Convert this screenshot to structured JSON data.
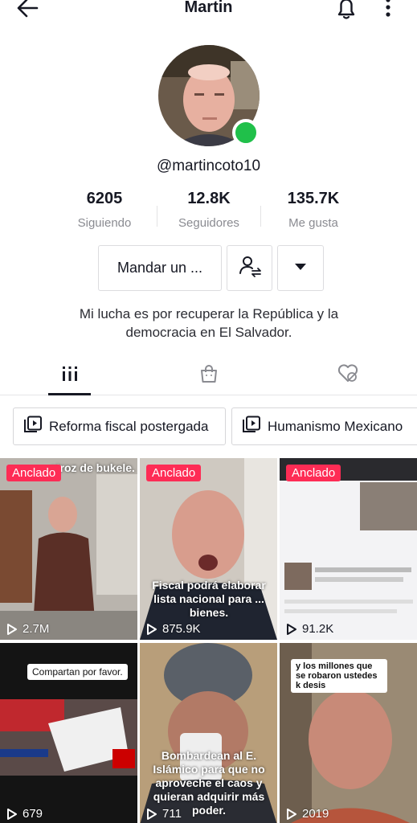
{
  "header": {
    "title": "Martin",
    "back_icon": "arrow-left-icon",
    "bell_icon": "bell-icon",
    "more_icon": "more-vertical-icon"
  },
  "profile": {
    "handle": "@martincoto10",
    "online_color": "#20c04a",
    "bio": "Mi lucha es por recuperar la República y la democracia en El Salvador."
  },
  "stats": [
    {
      "value": "6205",
      "label": "Siguiendo"
    },
    {
      "value": "12.8K",
      "label": "Seguidores"
    },
    {
      "value": "135.7K",
      "label": "Me gusta"
    }
  ],
  "actions": {
    "message_label": "Mandar un ...",
    "friend_icon": "user-swap-icon",
    "dropdown_icon": "caret-down-icon"
  },
  "tabs": [
    {
      "icon": "grid-icon",
      "active": true
    },
    {
      "icon": "shopping-bag-icon",
      "active": false
    },
    {
      "icon": "liked-hidden-icon",
      "active": false
    }
  ],
  "playlists": [
    {
      "label": "Reforma fiscal postergada"
    },
    {
      "label": "Humanismo Mexicano"
    }
  ],
  "pinned_label": "Anclado",
  "accent_color": "#fe2c55",
  "videos": [
    {
      "pinned": true,
      "views": "2.7M",
      "top_text": "atroz de bukele."
    },
    {
      "pinned": true,
      "views": "875.9K",
      "caption": "Fiscal podrá elaborar lista nacional para ... bienes."
    },
    {
      "pinned": true,
      "views": "91.2K"
    },
    {
      "pinned": false,
      "views": "679",
      "note": "Compartan por favor."
    },
    {
      "pinned": false,
      "views": "711",
      "caption": "Bombardean al E. Islámico para que no aproveche el caos y quieran adquirir más poder."
    },
    {
      "pinned": false,
      "views": "2019",
      "note": "y los millones que se robaron ustedes k desis"
    }
  ]
}
